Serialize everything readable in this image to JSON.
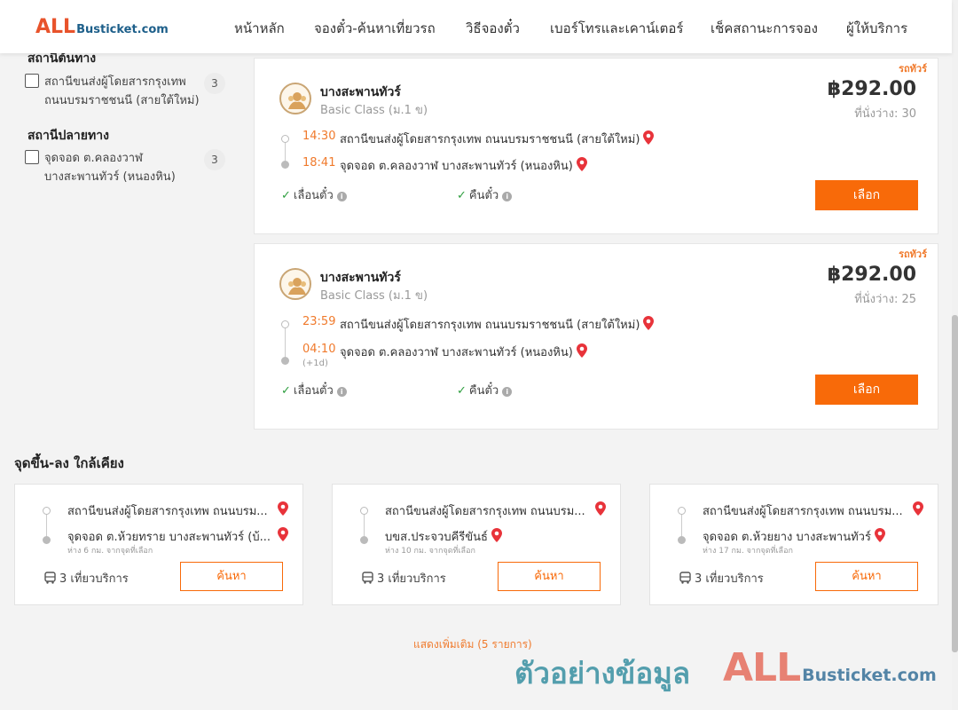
{
  "header": {
    "logo": {
      "all": "ALL",
      "rest": "Busticket.com"
    },
    "nav": [
      "หน้าหลัก",
      "จองตั๋ว-ค้นหาเที่ยวรถ",
      "วิธีจองตั๋ว",
      "เบอร์โทรและเคาน์เตอร์",
      "เช็คสถานะการจอง",
      "ผู้ให้บริการ"
    ]
  },
  "filters": {
    "origin_heading": "สถานีต้นทาง",
    "origin_items": [
      {
        "line1": "สถานีขนส่งผู้โดยสารกรุงเทพ",
        "line2": "ถนนบรมราชชนนี (สายใต้ใหม่)",
        "count": "3"
      }
    ],
    "destination_heading": "สถานีปลายทาง",
    "destination_items": [
      {
        "line1": "จุดจอด ต.คลองวาฬ",
        "line2": "บางสะพานทัวร์ (หนองหิน)",
        "count": "3"
      }
    ]
  },
  "trips": [
    {
      "tag": "รถทัวร์",
      "operator": "บางสะพานทัวร์",
      "class": "Basic Class (ม.1 ข)",
      "price": "฿292.00",
      "seats": "ที่นั่งว่าง: 30",
      "depart_time": "14:30",
      "depart_place": "สถานีขนส่งผู้โดยสารกรุงเทพ ถนนบรมราชชนนี (สายใต้ใหม่)",
      "arrive_time": "18:41",
      "arrive_place": "จุดจอด ต.คลองวาฬ บางสะพานทัวร์ (หนองหิน)",
      "arrive_note": "",
      "feature_postpone": "เลื่อนตั๋ว",
      "feature_refund": "คืนตั๋ว",
      "select_label": "เลือก"
    },
    {
      "tag": "รถทัวร์",
      "operator": "บางสะพานทัวร์",
      "class": "Basic Class (ม.1 ข)",
      "price": "฿292.00",
      "seats": "ที่นั่งว่าง: 25",
      "depart_time": "23:59",
      "depart_place": "สถานีขนส่งผู้โดยสารกรุงเทพ ถนนบรมราชชนนี (สายใต้ใหม่)",
      "arrive_time": "04:10",
      "arrive_place": "จุดจอด ต.คลองวาฬ บางสะพานทัวร์ (หนองหิน)",
      "arrive_note": "(+1d)",
      "feature_postpone": "เลื่อนตั๋ว",
      "feature_refund": "คืนตั๋ว",
      "select_label": "เลือก"
    }
  ],
  "nearby": {
    "title": "จุดขึ้น-ลง ใกล้เคียง",
    "cards": [
      {
        "from": "สถานีขนส่งผู้โดยสารกรุงเทพ ถนนบรม...",
        "to": "จุดจอด ต.ห้วยทราย บางสะพานทัวร์ (บ้...",
        "distance": "ห่าง 6 กม. จากจุดที่เลือก",
        "trips": "3 เที่ยวบริการ",
        "search_label": "ค้นหา"
      },
      {
        "from": "สถานีขนส่งผู้โดยสารกรุงเทพ ถนนบรม...",
        "to": "บขส.ประจวบคีรีขันธ์",
        "distance": "ห่าง 10 กม. จากจุดที่เลือก",
        "trips": "3 เที่ยวบริการ",
        "search_label": "ค้นหา"
      },
      {
        "from": "สถานีขนส่งผู้โดยสารกรุงเทพ ถนนบรม...",
        "to": "จุดจอด ต.ห้วยยาง บางสะพานทัวร์",
        "distance": "ห่าง 17 กม. จากจุดที่เลือก",
        "trips": "3 เที่ยวบริการ",
        "search_label": "ค้นหา"
      }
    ]
  },
  "show_more": "แสดงเพิ่มเติม (5 รายการ)",
  "watermark": {
    "text": "ตัวอย่างข้อมูล",
    "logo_all": "ALL",
    "logo_rest": "Busticket.com"
  },
  "colors": {
    "accent": "#f86a09",
    "time": "#f07a2c",
    "pin": "#e8333a",
    "check": "#2e9e3f"
  }
}
